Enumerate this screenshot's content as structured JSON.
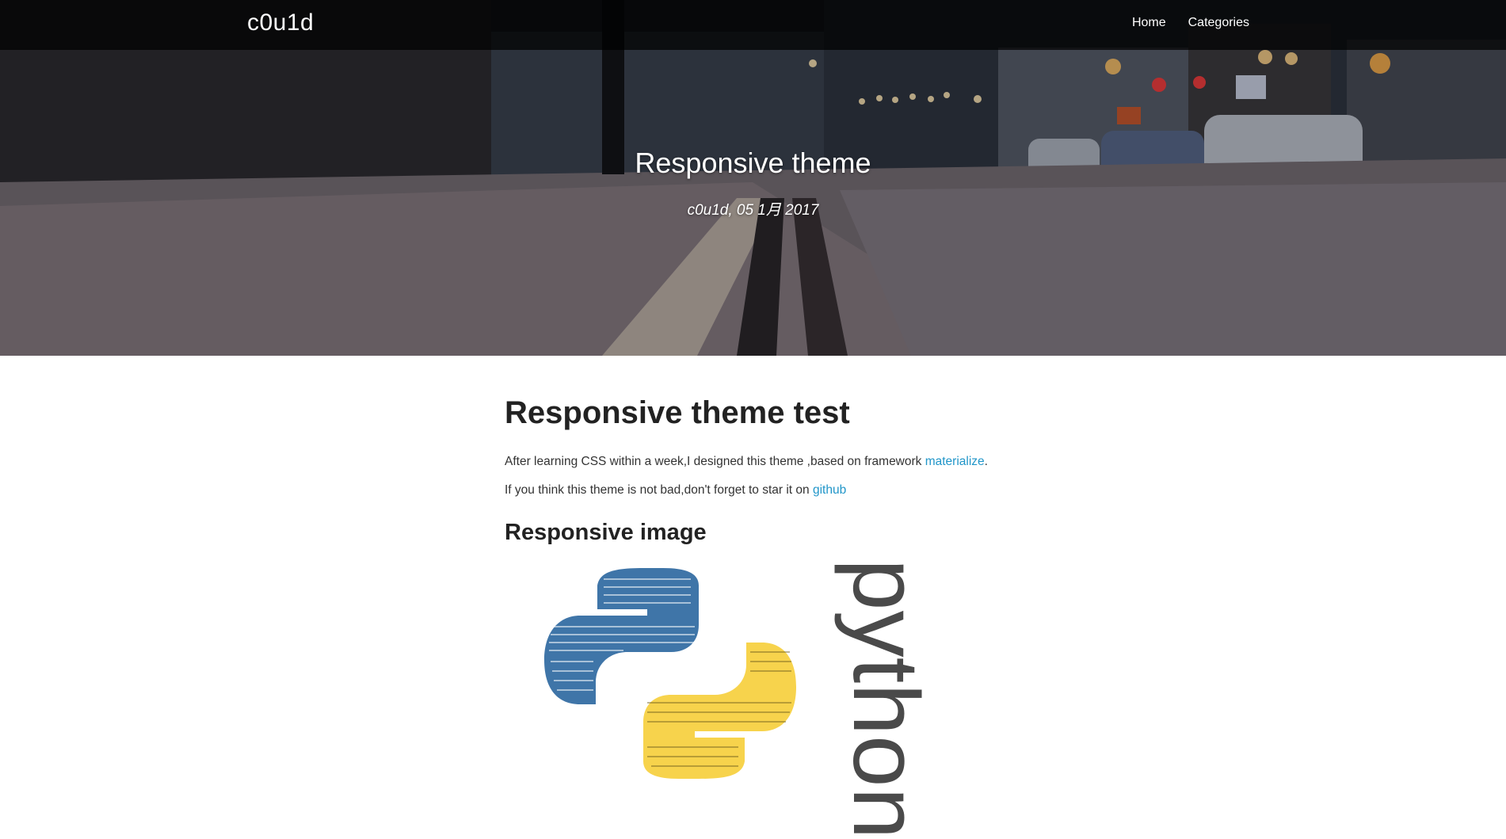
{
  "nav": {
    "brand": "c0u1d",
    "links": [
      {
        "label": "Home"
      },
      {
        "label": "Categories"
      }
    ]
  },
  "hero": {
    "title": "Responsive theme",
    "meta": "c0u1d, 05 1月 2017"
  },
  "article": {
    "title": "Responsive theme test",
    "para1_text": "After learning CSS within a week,I designed this theme ,based on framework ",
    "para1_link": "materialize",
    "para1_tail": ".",
    "para2_text": "If you think this theme is not bad,don't forget to star it on ",
    "para2_link": "github",
    "section_heading": "Responsive image",
    "image_word": "python"
  },
  "colors": {
    "link": "#2196c9",
    "python_blue": "#3f75a8",
    "python_yellow": "#f7d34c"
  }
}
